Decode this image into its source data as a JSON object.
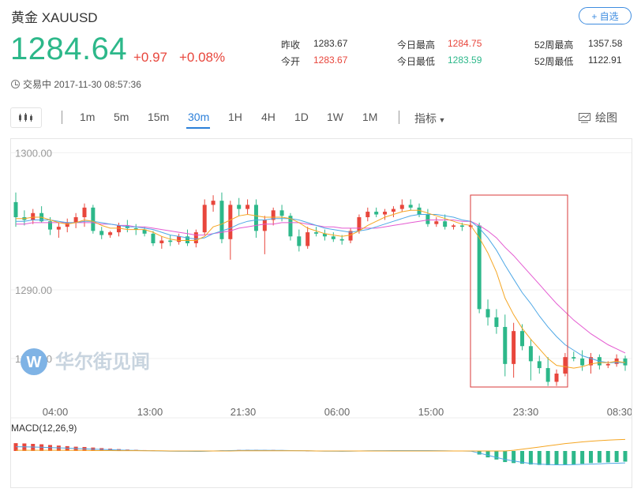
{
  "header": {
    "title": "黄金 XAUUSD",
    "follow_label": "+ 自选"
  },
  "quote": {
    "price": "1284.64",
    "change": "+0.97",
    "change_pct": "+0.08%",
    "status": "交易中 2017-11-30 08:57:36"
  },
  "stats": {
    "prev_close_label": "昨收",
    "prev_close": "1283.67",
    "open_label": "今开",
    "open": "1283.67",
    "high_label": "今日最高",
    "high": "1284.75",
    "low_label": "今日最低",
    "low": "1283.59",
    "w52_high_label": "52周最高",
    "w52_high": "1357.58",
    "w52_low_label": "52周最低",
    "w52_low": "1122.91"
  },
  "toolbar": {
    "tabs": [
      "1m",
      "5m",
      "15m",
      "30m",
      "1H",
      "4H",
      "1D",
      "1W",
      "1M"
    ],
    "active_tab": "30m",
    "indicator_label": "指标",
    "draw_label": "绘图"
  },
  "watermark": "华尔街见闻",
  "colors": {
    "up": "#e8463c",
    "down": "#2db88a",
    "ma_orange": "#f5a623",
    "ma_blue": "#4fa8e6",
    "ma_magenta": "#e45ad1",
    "accent": "#2b7fd9",
    "highlight_box": "#d9383a"
  },
  "chart_data": {
    "type": "candlestick",
    "ylim": [
      1282.0,
      1301.0
    ],
    "y_ticks": [
      "1300.00",
      "1290.00",
      "1285.00"
    ],
    "x_ticks": [
      "04:00",
      "13:00",
      "21:30",
      "06:00",
      "15:00",
      "23:30",
      "08:30"
    ],
    "ohlc": [
      [
        1296.4,
        1297.1,
        1294.6,
        1295.3
      ],
      [
        1295.3,
        1295.8,
        1294.7,
        1295.1
      ],
      [
        1295.1,
        1295.9,
        1294.8,
        1295.6
      ],
      [
        1295.6,
        1296.1,
        1294.9,
        1295.0
      ],
      [
        1295.0,
        1295.3,
        1294.0,
        1294.4
      ],
      [
        1294.4,
        1294.9,
        1293.8,
        1294.6
      ],
      [
        1294.6,
        1295.2,
        1294.2,
        1294.9
      ],
      [
        1294.9,
        1295.6,
        1294.5,
        1295.3
      ],
      [
        1295.3,
        1296.3,
        1294.6,
        1296.0
      ],
      [
        1296.0,
        1296.2,
        1294.1,
        1294.3
      ],
      [
        1294.3,
        1294.6,
        1293.7,
        1294.0
      ],
      [
        1294.0,
        1294.3,
        1293.8,
        1294.2
      ],
      [
        1294.2,
        1294.9,
        1293.9,
        1294.7
      ],
      [
        1294.7,
        1295.1,
        1294.2,
        1294.5
      ],
      [
        1294.5,
        1294.8,
        1294.0,
        1294.4
      ],
      [
        1294.4,
        1294.6,
        1293.9,
        1294.1
      ],
      [
        1294.1,
        1294.3,
        1293.2,
        1293.4
      ],
      [
        1293.4,
        1293.9,
        1293.0,
        1293.6
      ],
      [
        1293.6,
        1294.0,
        1293.2,
        1293.5
      ],
      [
        1293.5,
        1294.1,
        1293.3,
        1293.9
      ],
      [
        1293.9,
        1294.4,
        1293.2,
        1293.4
      ],
      [
        1293.4,
        1294.4,
        1293.1,
        1294.2
      ],
      [
        1294.2,
        1296.6,
        1294.0,
        1296.2
      ],
      [
        1296.2,
        1296.9,
        1295.7,
        1296.5
      ],
      [
        1296.5,
        1297.1,
        1293.4,
        1293.7
      ],
      [
        1293.7,
        1296.5,
        1292.2,
        1296.2
      ],
      [
        1296.2,
        1296.7,
        1295.4,
        1295.9
      ],
      [
        1295.9,
        1296.6,
        1295.5,
        1296.2
      ],
      [
        1296.2,
        1296.6,
        1293.8,
        1294.3
      ],
      [
        1294.3,
        1295.4,
        1292.6,
        1295.1
      ],
      [
        1295.1,
        1296.0,
        1294.7,
        1295.8
      ],
      [
        1295.8,
        1296.2,
        1295.0,
        1295.4
      ],
      [
        1295.4,
        1295.6,
        1293.6,
        1293.9
      ],
      [
        1293.9,
        1294.4,
        1292.8,
        1293.2
      ],
      [
        1293.2,
        1294.6,
        1293.0,
        1294.2
      ],
      [
        1294.2,
        1294.6,
        1293.9,
        1294.1
      ],
      [
        1294.1,
        1294.4,
        1293.6,
        1293.9
      ],
      [
        1293.9,
        1294.2,
        1293.5,
        1293.7
      ],
      [
        1293.7,
        1294.0,
        1293.3,
        1293.6
      ],
      [
        1293.6,
        1294.5,
        1293.4,
        1294.3
      ],
      [
        1294.3,
        1295.5,
        1294.1,
        1295.3
      ],
      [
        1295.3,
        1296.0,
        1295.0,
        1295.7
      ],
      [
        1295.7,
        1296.0,
        1295.3,
        1295.5
      ],
      [
        1295.5,
        1295.9,
        1295.1,
        1295.7
      ],
      [
        1295.7,
        1296.1,
        1295.3,
        1295.9
      ],
      [
        1295.9,
        1296.6,
        1295.7,
        1296.2
      ],
      [
        1296.2,
        1296.6,
        1295.8,
        1296.0
      ],
      [
        1296.0,
        1296.3,
        1295.3,
        1295.5
      ],
      [
        1295.5,
        1295.9,
        1294.6,
        1294.8
      ],
      [
        1294.8,
        1295.3,
        1294.6,
        1295.0
      ],
      [
        1295.0,
        1295.5,
        1294.4,
        1294.6
      ],
      [
        1294.6,
        1294.8,
        1294.4,
        1294.7
      ],
      [
        1294.7,
        1294.9,
        1294.3,
        1294.6
      ],
      [
        1294.6,
        1294.8,
        1294.4,
        1294.7
      ],
      [
        1294.7,
        1294.9,
        1288.3,
        1288.6
      ],
      [
        1288.6,
        1289.3,
        1287.4,
        1288.0
      ],
      [
        1288.0,
        1288.6,
        1286.8,
        1287.3
      ],
      [
        1287.3,
        1288.2,
        1283.7,
        1284.6
      ],
      [
        1284.6,
        1287.6,
        1283.6,
        1287.0
      ],
      [
        1287.0,
        1287.5,
        1285.6,
        1285.9
      ],
      [
        1285.9,
        1286.4,
        1283.4,
        1284.8
      ],
      [
        1284.8,
        1285.2,
        1283.9,
        1284.3
      ],
      [
        1284.3,
        1285.1,
        1283.0,
        1283.3
      ],
      [
        1283.3,
        1284.2,
        1283.0,
        1283.9
      ],
      [
        1283.9,
        1285.4,
        1283.7,
        1285.1
      ],
      [
        1285.1,
        1285.5,
        1284.8,
        1285.0
      ],
      [
        1285.0,
        1285.6,
        1284.1,
        1284.5
      ],
      [
        1284.5,
        1285.4,
        1283.9,
        1285.1
      ],
      [
        1285.1,
        1285.3,
        1284.2,
        1284.5
      ],
      [
        1284.5,
        1284.8,
        1284.3,
        1284.6
      ],
      [
        1284.6,
        1285.3,
        1284.4,
        1285.0
      ],
      [
        1285.0,
        1285.2,
        1284.1,
        1284.5
      ]
    ],
    "ma_fast": [
      1295.2,
      1295.2,
      1295.3,
      1295.3,
      1295.1,
      1294.9,
      1294.8,
      1294.9,
      1295.1,
      1295.0,
      1294.7,
      1294.5,
      1294.5,
      1294.4,
      1294.4,
      1294.4,
      1294.2,
      1293.9,
      1293.7,
      1293.6,
      1293.6,
      1293.6,
      1293.9,
      1294.6,
      1294.8,
      1295.1,
      1295.4,
      1295.5,
      1295.4,
      1295.3,
      1295.3,
      1295.3,
      1295.2,
      1294.9,
      1294.5,
      1294.3,
      1294.1,
      1294.0,
      1293.9,
      1294.0,
      1294.3,
      1294.7,
      1295.0,
      1295.3,
      1295.5,
      1295.7,
      1295.8,
      1295.8,
      1295.6,
      1295.4,
      1295.2,
      1295.0,
      1294.8,
      1294.7,
      1293.8,
      1292.7,
      1291.3,
      1289.4,
      1288.2,
      1287.2,
      1286.4,
      1285.7,
      1285.0,
      1284.5,
      1284.4,
      1284.3,
      1284.4,
      1284.6,
      1284.7,
      1284.7,
      1284.8,
      1284.7
    ],
    "ma_mid": [
      1295.0,
      1295.0,
      1295.1,
      1295.1,
      1295.1,
      1295.0,
      1294.9,
      1294.9,
      1295.0,
      1295.0,
      1294.9,
      1294.8,
      1294.7,
      1294.6,
      1294.6,
      1294.5,
      1294.4,
      1294.2,
      1294.0,
      1293.9,
      1293.8,
      1293.7,
      1293.8,
      1294.1,
      1294.3,
      1294.5,
      1294.8,
      1295.0,
      1295.1,
      1295.1,
      1295.2,
      1295.2,
      1295.2,
      1295.1,
      1294.9,
      1294.7,
      1294.5,
      1294.4,
      1294.3,
      1294.2,
      1294.3,
      1294.4,
      1294.6,
      1294.8,
      1295.0,
      1295.2,
      1295.4,
      1295.5,
      1295.5,
      1295.5,
      1295.4,
      1295.3,
      1295.1,
      1295.0,
      1294.5,
      1293.8,
      1292.9,
      1291.8,
      1290.8,
      1289.8,
      1289.0,
      1288.1,
      1287.3,
      1286.6,
      1286.0,
      1285.6,
      1285.2,
      1285.0,
      1284.8,
      1284.7,
      1284.7,
      1284.7
    ],
    "ma_slow": [
      1294.8,
      1294.8,
      1294.9,
      1294.9,
      1294.9,
      1294.9,
      1294.9,
      1294.9,
      1294.9,
      1294.9,
      1294.8,
      1294.8,
      1294.7,
      1294.7,
      1294.6,
      1294.6,
      1294.5,
      1294.4,
      1294.3,
      1294.2,
      1294.1,
      1294.0,
      1294.0,
      1294.1,
      1294.2,
      1294.3,
      1294.5,
      1294.6,
      1294.7,
      1294.8,
      1294.8,
      1294.9,
      1294.9,
      1294.9,
      1294.8,
      1294.7,
      1294.6,
      1294.6,
      1294.5,
      1294.5,
      1294.5,
      1294.5,
      1294.5,
      1294.6,
      1294.7,
      1294.8,
      1294.9,
      1295.0,
      1295.1,
      1295.1,
      1295.1,
      1295.1,
      1295.0,
      1295.0,
      1294.7,
      1294.3,
      1293.8,
      1293.1,
      1292.5,
      1291.8,
      1291.1,
      1290.4,
      1289.7,
      1289.0,
      1288.4,
      1287.8,
      1287.3,
      1286.8,
      1286.4,
      1286.0,
      1285.7,
      1285.4
    ],
    "macd": {
      "label": "MACD(12,26,9)",
      "hist": [
        0.55,
        0.53,
        0.5,
        0.47,
        0.42,
        0.38,
        0.34,
        0.3,
        0.28,
        0.24,
        0.2,
        0.16,
        0.13,
        0.1,
        0.08,
        0.06,
        0.04,
        0.02,
        0.0,
        -0.02,
        -0.03,
        -0.04,
        -0.02,
        0.02,
        0.04,
        0.05,
        0.07,
        0.08,
        0.08,
        0.07,
        0.07,
        0.06,
        0.05,
        0.03,
        0.01,
        -0.01,
        -0.02,
        -0.03,
        -0.03,
        -0.02,
        -0.01,
        0.0,
        0.02,
        0.03,
        0.04,
        0.05,
        0.05,
        0.05,
        0.04,
        0.03,
        0.02,
        0.01,
        0.0,
        -0.01,
        -0.25,
        -0.45,
        -0.6,
        -0.78,
        -0.85,
        -0.9,
        -0.95,
        -0.98,
        -1.0,
        -1.0,
        -0.98,
        -0.95,
        -0.9,
        -0.85,
        -0.82,
        -0.8,
        -0.78,
        -0.75
      ],
      "line1": [
        0.3,
        0.29,
        0.28,
        0.26,
        0.24,
        0.22,
        0.2,
        0.17,
        0.15,
        0.13,
        0.11,
        0.09,
        0.07,
        0.05,
        0.04,
        0.03,
        0.01,
        0.0,
        -0.01,
        -0.02,
        -0.02,
        -0.03,
        -0.02,
        0.0,
        0.02,
        0.03,
        0.04,
        0.05,
        0.05,
        0.05,
        0.04,
        0.04,
        0.03,
        0.02,
        0.01,
        0.0,
        -0.01,
        -0.01,
        -0.02,
        -0.01,
        0.0,
        0.01,
        0.02,
        0.02,
        0.03,
        0.03,
        0.03,
        0.03,
        0.03,
        0.02,
        0.01,
        0.0,
        0.0,
        -0.01,
        -0.15,
        -0.3,
        -0.45,
        -0.6,
        -0.7,
        -0.8,
        -0.87,
        -0.92,
        -0.95,
        -0.97,
        -0.97,
        -0.96,
        -0.94,
        -0.92,
        -0.9,
        -0.88,
        -0.86,
        -0.84
      ],
      "line2": [
        0.05,
        0.05,
        0.05,
        0.05,
        0.05,
        0.05,
        0.04,
        0.04,
        0.04,
        0.03,
        0.03,
        0.03,
        0.02,
        0.02,
        0.02,
        0.01,
        0.01,
        0.01,
        0.0,
        0.0,
        0.0,
        0.0,
        0.0,
        0.0,
        0.0,
        0.0,
        0.01,
        0.01,
        0.01,
        0.01,
        0.01,
        0.01,
        0.01,
        0.01,
        0.01,
        0.0,
        0.0,
        0.0,
        0.0,
        0.0,
        0.0,
        0.0,
        0.0,
        0.0,
        0.0,
        0.0,
        0.0,
        0.0,
        0.0,
        0.0,
        0.0,
        0.0,
        0.0,
        0.0,
        0.0,
        0.0,
        0.0,
        0.0,
        0.05,
        0.12,
        0.2,
        0.28,
        0.36,
        0.44,
        0.52,
        0.58,
        0.64,
        0.69,
        0.73,
        0.76,
        0.79,
        0.81
      ]
    }
  }
}
